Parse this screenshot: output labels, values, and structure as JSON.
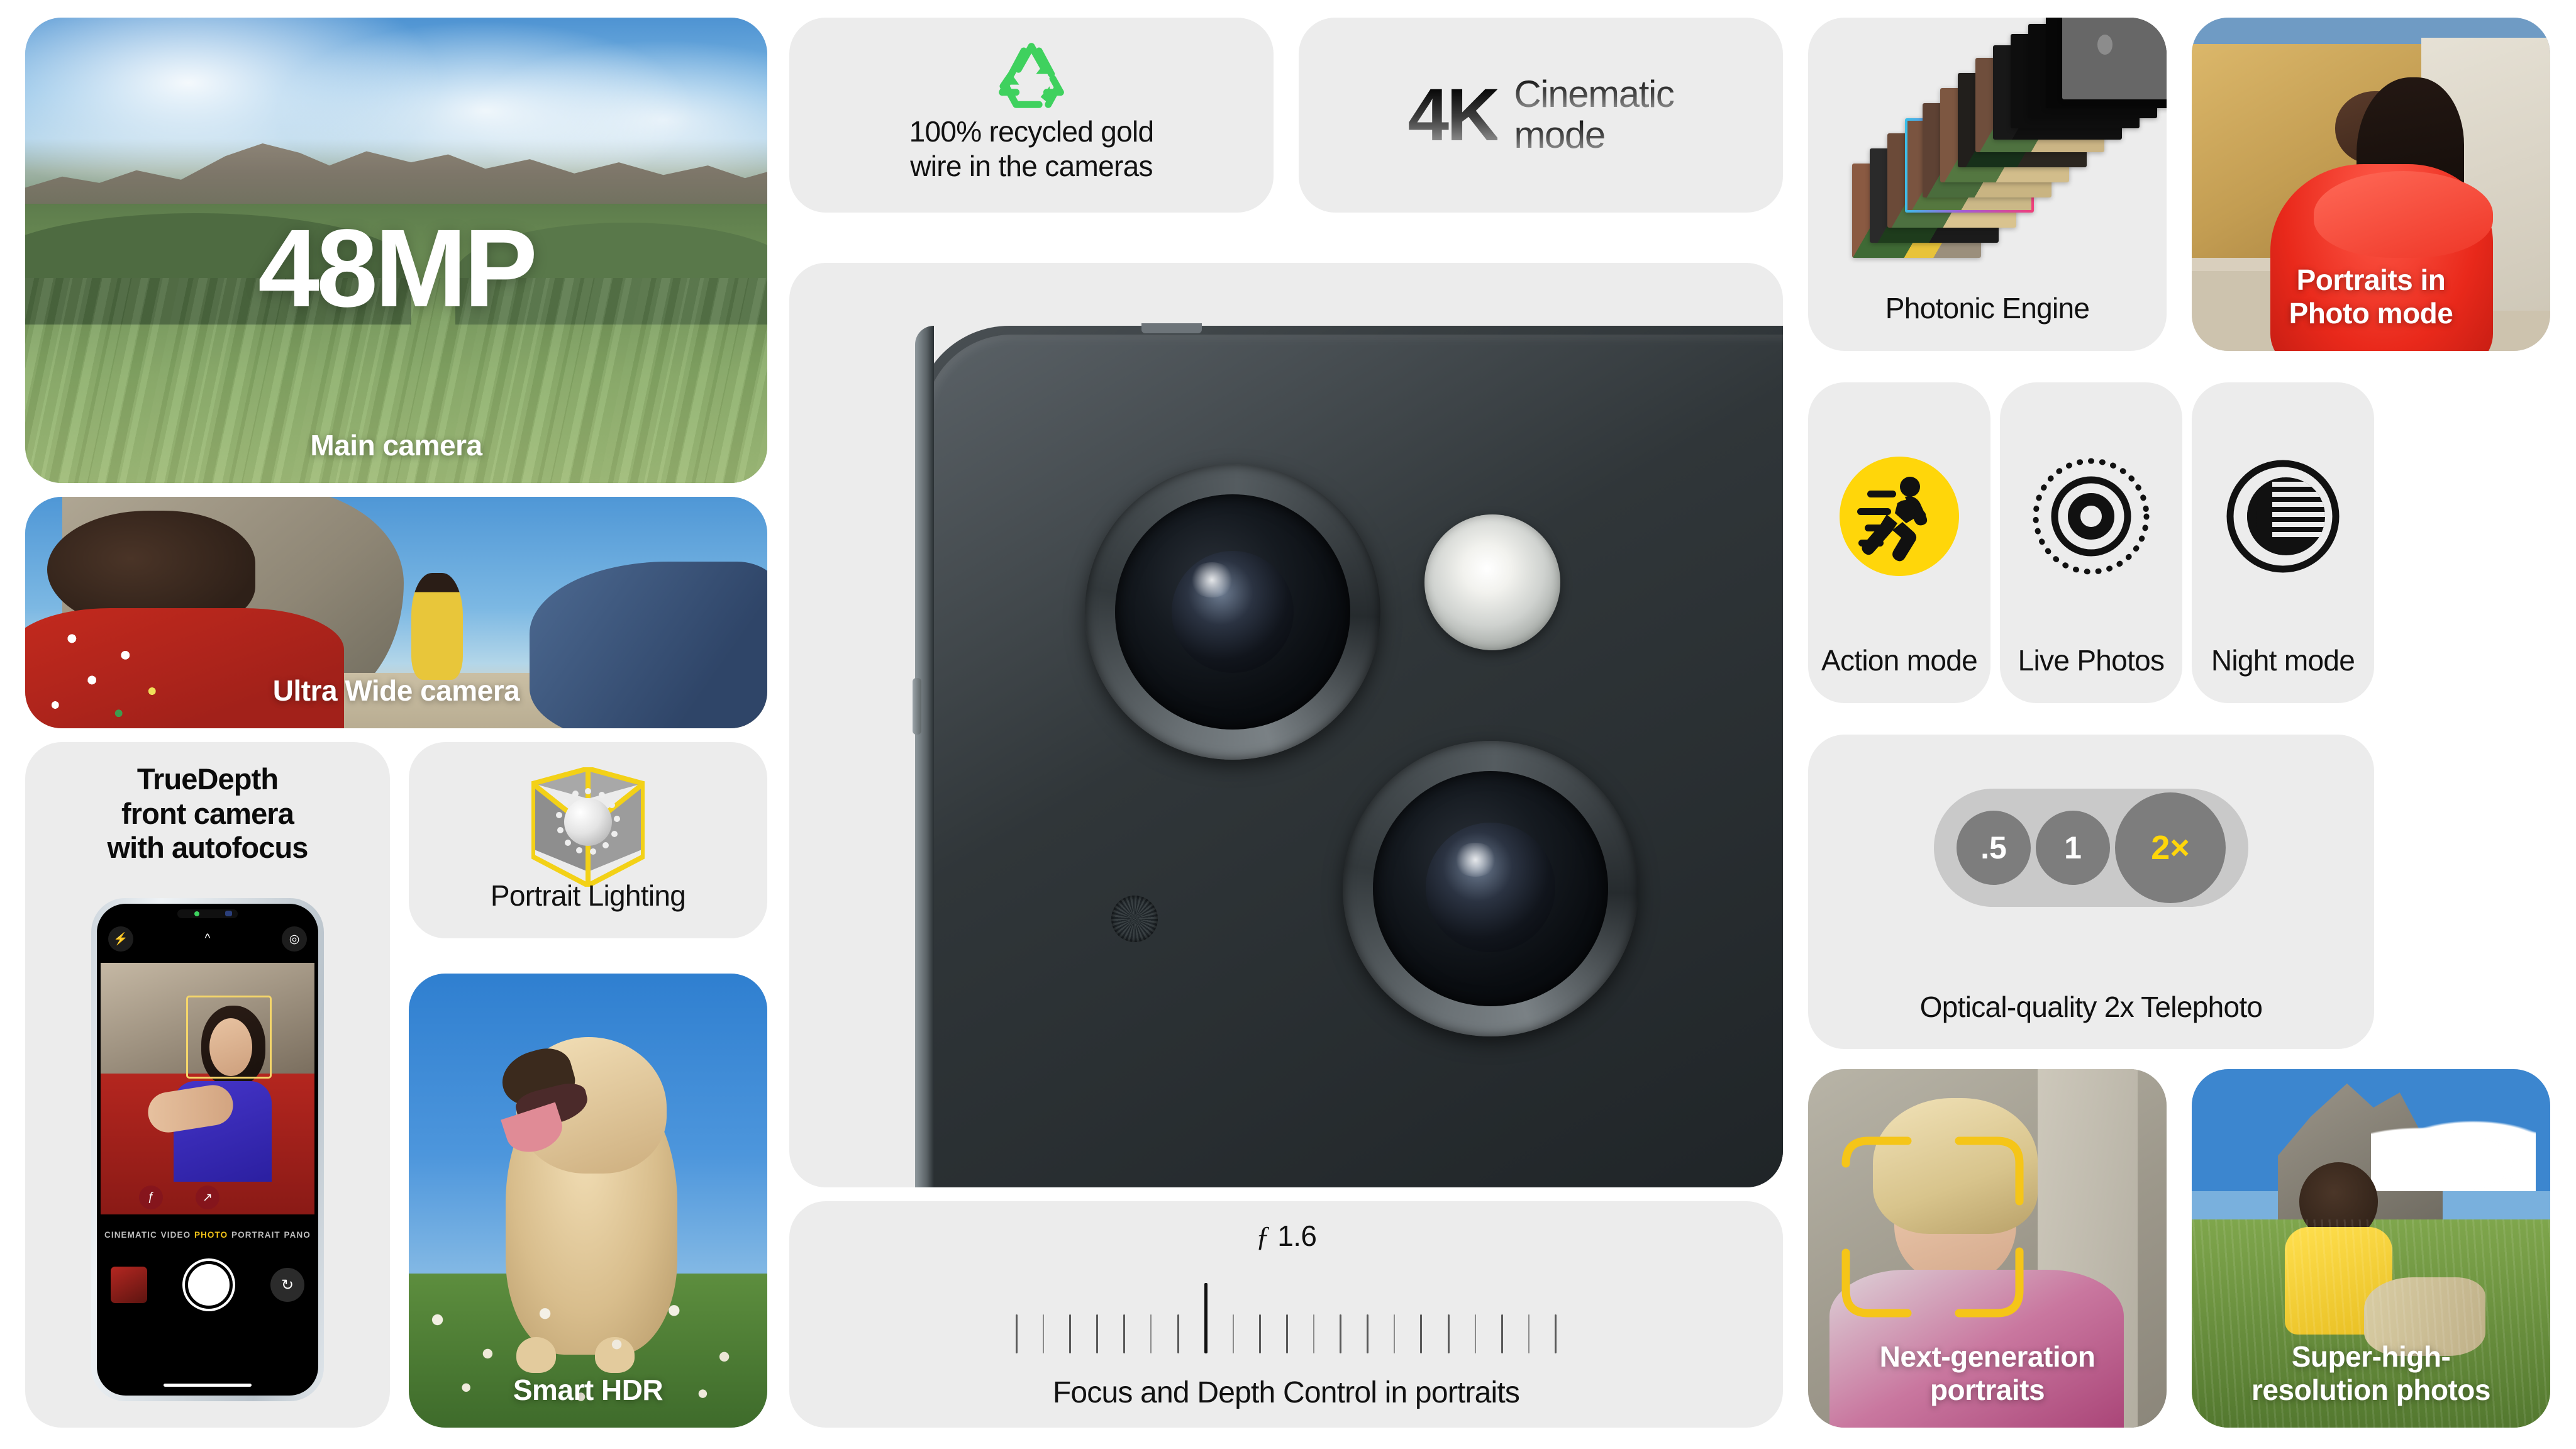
{
  "page": {
    "title": "iPhone camera features",
    "background_color": "#ffffff",
    "card_color": "#ececec",
    "accent_yellow": "#FFD60A",
    "accent_green": "#3fd15e"
  },
  "cards": {
    "main_camera": {
      "headline": "48MP",
      "caption": "Main camera",
      "image_alt": "Alpine valley with rocky peaks and green meadows"
    },
    "ultra_wide": {
      "caption": "Ultra Wide camera",
      "image_alt": "Person in red embroidered jacket on a beach with dancer in yellow"
    },
    "truedepth": {
      "title_line1": "TrueDepth",
      "title_line2": "front camera",
      "title_line3": "with autofocus",
      "camera_ui": {
        "modes": [
          "CINEMATIC",
          "VIDEO",
          "PHOTO",
          "PORTRAIT",
          "PANO"
        ],
        "active_mode": "PHOTO",
        "active_mode_color": "#f5c518",
        "flash_icon": "flash-icon",
        "chevron_icon": "chevron-up-icon",
        "live_icon": "live-photo-icon",
        "depth_icon": "f-aperture-icon",
        "expand_icon": "expand-arrows-icon",
        "shutter_icon": "shutter-button",
        "flip_icon": "flip-camera-icon",
        "thumbnail_label": "last-photo-thumbnail"
      }
    },
    "portrait_lighting": {
      "caption": "Portrait Lighting",
      "icon": "lighting-cube-icon"
    },
    "smart_hdr": {
      "caption": "Smart HDR",
      "image_alt": "Shaggy dog panting in a clover meadow"
    },
    "recycled_gold": {
      "line1": "100% recycled gold",
      "line2": "wire in the cameras",
      "icon": "recycling-arrows-icon",
      "icon_color": "#3fd15e"
    },
    "cinematic": {
      "resolution": "4K",
      "line1": "Cinematic",
      "line2": "mode"
    },
    "hero": {
      "image_alt": "Close-up of iPhone dual rear camera module in midnight black"
    },
    "focus_depth": {
      "aperture_symbol": "ƒ",
      "aperture_value": "1.6",
      "caption": "Focus and Depth Control in portraits",
      "ticks_total": 21,
      "center_tick_index": 7
    },
    "photonic_engine": {
      "caption": "Photonic Engine",
      "icon": "photo-stack-icon",
      "frames": 14
    },
    "portraits_photo_mode": {
      "caption_line1": "Portraits in",
      "caption_line2": "Photo mode",
      "image_alt": "Woman in red ruffled dress laughing against sandstone wall"
    },
    "action_mode": {
      "caption": "Action mode",
      "icon": "running-person-icon"
    },
    "live_photos": {
      "caption": "Live Photos",
      "icon": "live-photos-rings-icon"
    },
    "night_mode": {
      "caption": "Night mode",
      "icon": "crescent-moon-icon"
    },
    "telephoto": {
      "caption": "Optical-quality 2x Telephoto",
      "zoom_options": [
        {
          "label": ".5",
          "active": false
        },
        {
          "label": "1",
          "active": false
        },
        {
          "label": "2×",
          "active": true
        }
      ],
      "active_color": "#FFD60A"
    },
    "next_gen_portraits": {
      "caption_line1": "Next-generation",
      "caption_line2": "portraits",
      "focus_bracket_color": "#F5C518",
      "image_alt": "Blond person in pink sweater with yellow focus brackets"
    },
    "super_high_res": {
      "caption_line1": "Super-high-",
      "caption_line2": "resolution photos",
      "image_alt": "Person in yellow vest sitting in alpine meadow"
    }
  }
}
